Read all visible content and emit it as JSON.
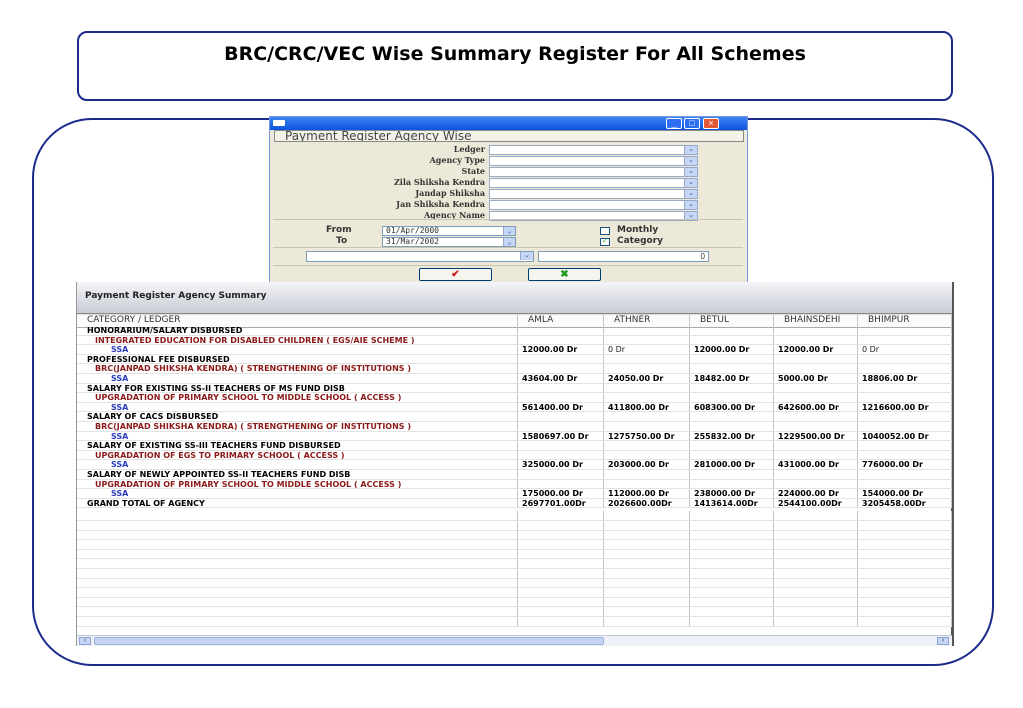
{
  "slide": {
    "title": "BRC/CRC/VEC Wise Summary  Register  For All Schemes"
  },
  "dialog": {
    "heading": "Payment Register Agency Wise",
    "fields": [
      {
        "label": "Ledger"
      },
      {
        "label": "Agency Type"
      },
      {
        "label": "State"
      },
      {
        "label": "Zila Shiksha Kendra"
      },
      {
        "label": "Jandap Shiksha"
      },
      {
        "label": "Jan Shiksha Kendra"
      },
      {
        "label": "Agency Name"
      }
    ],
    "from_label": "From",
    "from_value": "01/Apr/2000",
    "to_label": "To",
    "to_value": "31/Mar/2002",
    "monthly_label": "Monthly",
    "category_label": "Category",
    "number_value": "0",
    "ok_glyph": "✔",
    "cancel_glyph": "✖"
  },
  "summary": {
    "title": "Payment Register Agency Summary",
    "columns": [
      "CATEGORY / LEDGER",
      "AMLA",
      "ATHNER",
      "BETUL",
      "BHAINSDEHI",
      "BHIMPUR"
    ],
    "rows": [
      {
        "type": "cat",
        "label": "HONORARIUM/SALARY DISBURSED",
        "values": [
          "",
          "",
          "",
          "",
          ""
        ]
      },
      {
        "type": "scheme",
        "label": "INTEGRATED EDUCATION FOR DISABLED CHILDREN ( EGS/AIE SCHEME )",
        "values": [
          "",
          "",
          "",
          "",
          ""
        ]
      },
      {
        "type": "ssa",
        "label": "SSA",
        "values": [
          "12000.00 Dr",
          "0 Dr",
          "12000.00 Dr",
          "12000.00 Dr",
          "0 Dr"
        ]
      },
      {
        "type": "cat",
        "label": "PROFESSIONAL FEE DISBURSED",
        "values": [
          "",
          "",
          "",
          "",
          ""
        ]
      },
      {
        "type": "scheme",
        "label": "BRC(JANPAD SHIKSHA KENDRA) ( STRENGTHENING OF INSTITUTIONS )",
        "values": [
          "",
          "",
          "",
          "",
          ""
        ]
      },
      {
        "type": "ssa",
        "label": "SSA",
        "values": [
          "43604.00 Dr",
          "24050.00 Dr",
          "18482.00 Dr",
          "5000.00 Dr",
          "18806.00 Dr"
        ]
      },
      {
        "type": "cat",
        "label": "SALARY FOR EXISTING SS-II TEACHERS OF MS FUND DISB",
        "values": [
          "",
          "",
          "",
          "",
          ""
        ]
      },
      {
        "type": "scheme",
        "label": "UPGRADATION OF PRIMARY SCHOOL TO MIDDLE SCHOOL ( ACCESS )",
        "values": [
          "",
          "",
          "",
          "",
          ""
        ]
      },
      {
        "type": "ssa",
        "label": "SSA",
        "values": [
          "561400.00 Dr",
          "411800.00 Dr",
          "608300.00 Dr",
          "642600.00 Dr",
          "1216600.00 Dr"
        ]
      },
      {
        "type": "cat",
        "label": "SALARY OF CACS DISBURSED",
        "values": [
          "",
          "",
          "",
          "",
          ""
        ]
      },
      {
        "type": "scheme",
        "label": "BRC(JANPAD SHIKSHA KENDRA) ( STRENGTHENING OF INSTITUTIONS )",
        "values": [
          "",
          "",
          "",
          "",
          ""
        ]
      },
      {
        "type": "ssa",
        "label": "SSA",
        "values": [
          "1580697.00 Dr",
          "1275750.00 Dr",
          "255832.00 Dr",
          "1229500.00 Dr",
          "1040052.00 Dr"
        ]
      },
      {
        "type": "cat",
        "label": "SALARY OF EXISTING SS-III TEACHERS FUND DISBURSED",
        "values": [
          "",
          "",
          "",
          "",
          ""
        ]
      },
      {
        "type": "scheme",
        "label": "UPGRADATION OF EGS TO PRIMARY SCHOOL ( ACCESS )",
        "values": [
          "",
          "",
          "",
          "",
          ""
        ]
      },
      {
        "type": "ssa",
        "label": "SSA",
        "values": [
          "325000.00 Dr",
          "203000.00 Dr",
          "281000.00 Dr",
          "431000.00 Dr",
          "776000.00 Dr"
        ]
      },
      {
        "type": "cat",
        "label": "SALARY OF NEWLY APPOINTED SS-II TEACHERS FUND DISB",
        "values": [
          "",
          "",
          "",
          "",
          ""
        ]
      },
      {
        "type": "scheme",
        "label": "UPGRADATION OF PRIMARY SCHOOL TO MIDDLE SCHOOL ( ACCESS )",
        "values": [
          "",
          "",
          "",
          "",
          ""
        ]
      },
      {
        "type": "ssa",
        "label": "SSA",
        "values": [
          "175000.00 Dr",
          "112000.00 Dr",
          "238000.00 Dr",
          "224000.00 Dr",
          "154000.00 Dr"
        ]
      },
      {
        "type": "total",
        "label": "GRAND TOTAL OF AGENCY",
        "values": [
          "2697701.00Dr",
          "2026600.00Dr",
          "1413614.00Dr",
          "2544100.00Dr",
          "3205458.00Dr"
        ]
      }
    ]
  }
}
